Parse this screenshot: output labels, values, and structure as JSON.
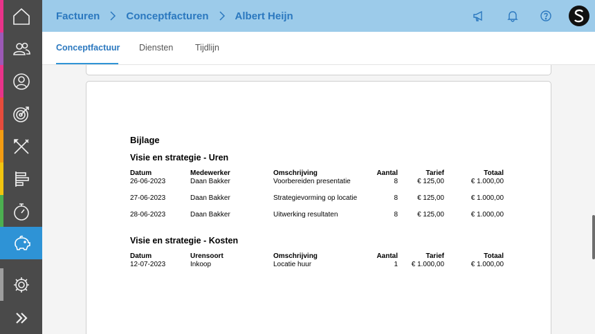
{
  "header": {
    "breadcrumbs": [
      "Facturen",
      "Conceptfacturen",
      "Albert Heijn"
    ],
    "icons": [
      "megaphone-icon",
      "bell-icon",
      "help-icon"
    ]
  },
  "tabs": [
    "Conceptfactuur",
    "Diensten",
    "Tijdlijn"
  ],
  "sidebar": {
    "items": [
      "home-icon",
      "users-icon",
      "user-icon",
      "target-icon",
      "tools-icon",
      "timeline-icon",
      "stopwatch-icon",
      "piggy-bank-icon",
      "settings-icon",
      "expand-icon"
    ],
    "active": "piggy-bank-icon",
    "stripe_colors": [
      "#e8338a",
      "#9b59b6",
      "#e8338a",
      "#e74c3c",
      "#f39c12",
      "#f1c40f",
      "#4caf50",
      "#2e93d6",
      "#9e9e9e"
    ]
  },
  "document": {
    "title": "Bijlage",
    "section_hours": {
      "title": "Visie en strategie - Uren",
      "headers": [
        "Datum",
        "Medewerker",
        "Omschrijving",
        "Aantal",
        "Tarief",
        "Totaal"
      ],
      "rows": [
        [
          "26-06-2023",
          "Daan Bakker",
          "Voorbereiden presentatie",
          "8",
          "€ 125,00",
          "€ 1.000,00"
        ],
        [
          "27-06-2023",
          "Daan Bakker",
          "Strategievorming op locatie",
          "8",
          "€ 125,00",
          "€ 1.000,00"
        ],
        [
          "28-06-2023",
          "Daan Bakker",
          "Uitwerking resultaten",
          "8",
          "€ 125,00",
          "€ 1.000,00"
        ]
      ]
    },
    "section_costs": {
      "title": "Visie en strategie - Kosten",
      "headers": [
        "Datum",
        "Urensoort",
        "Omschrijving",
        "Aantal",
        "Tarief",
        "Totaal"
      ],
      "rows": [
        [
          "12-07-2023",
          "Inkoop",
          "Locatie huur",
          "1",
          "€ 1.000,00",
          "€ 1.000,00"
        ]
      ]
    }
  },
  "colors": {
    "accent": "#2e93d6",
    "header_bg": "#9ccbea",
    "breadcrumb": "#2b78bf",
    "sidebar_bg": "#4a4a4a"
  }
}
